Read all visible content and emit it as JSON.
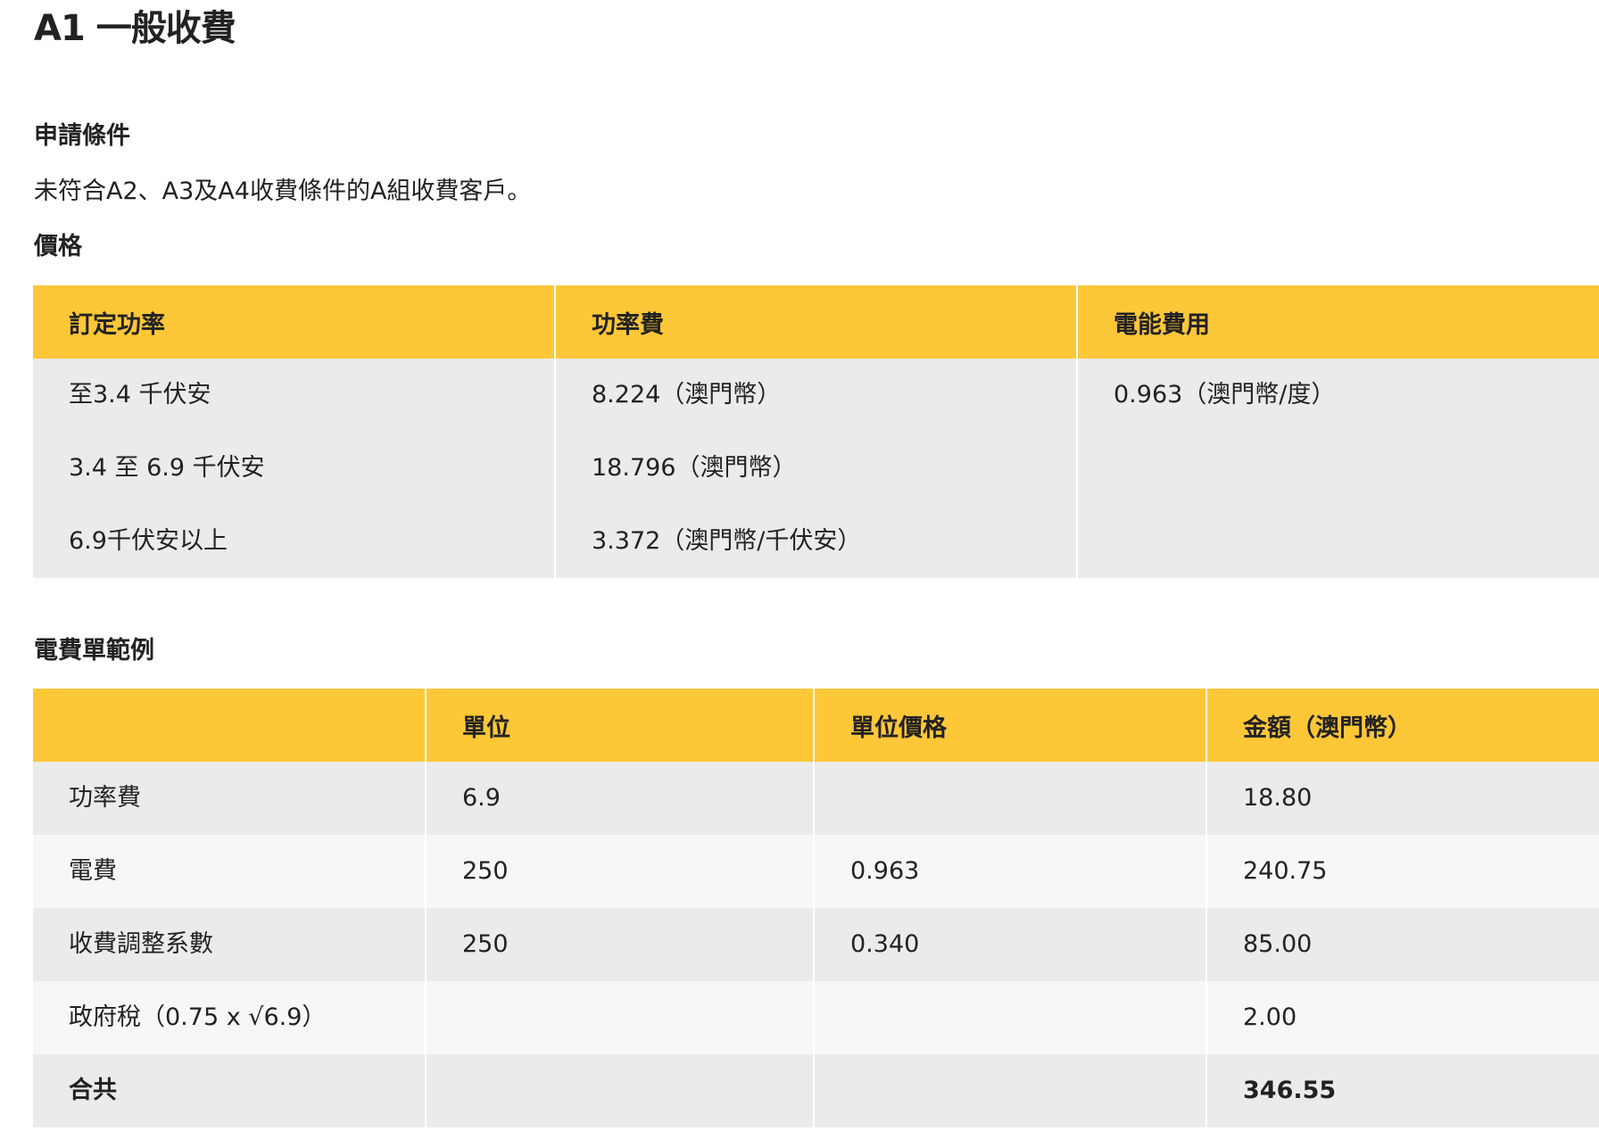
{
  "title": "A1 一般收費",
  "apply_heading": "申請條件",
  "apply_text": "未符合A2、A3及A4收費條件的A組收費客戶。",
  "price_heading": "價格",
  "price_table": {
    "headers": [
      "訂定功率",
      "功率費",
      "電能費用"
    ],
    "power_ranges": [
      "至3.4 千伏安",
      "3.4 至 6.9 千伏安",
      "6.9千伏安以上"
    ],
    "power_fees": [
      "8.224（澳門幣）",
      "18.796（澳門幣）",
      "3.372（澳門幣/千伏安）"
    ],
    "energy_fee": "0.963（澳門幣/度）"
  },
  "bill_heading": "電費單範例",
  "bill_table": {
    "headers": [
      "",
      "單位",
      "單位價格",
      "金額（澳門幣）"
    ],
    "rows": [
      [
        "功率費",
        "6.9",
        "",
        "18.80"
      ],
      [
        "電費",
        "250",
        "0.963",
        "240.75"
      ],
      [
        "收費調整系數",
        "250",
        "0.340",
        "85.00"
      ],
      [
        "政府稅（0.75 x √6.9）",
        "",
        "",
        "2.00"
      ],
      [
        "合共",
        "",
        "",
        "346.55"
      ]
    ]
  },
  "colors": {
    "header_bg": "#fdc738",
    "row_bg_dark": "#ebebeb",
    "row_bg_light": "#f7f7f7",
    "text": "#222222"
  }
}
